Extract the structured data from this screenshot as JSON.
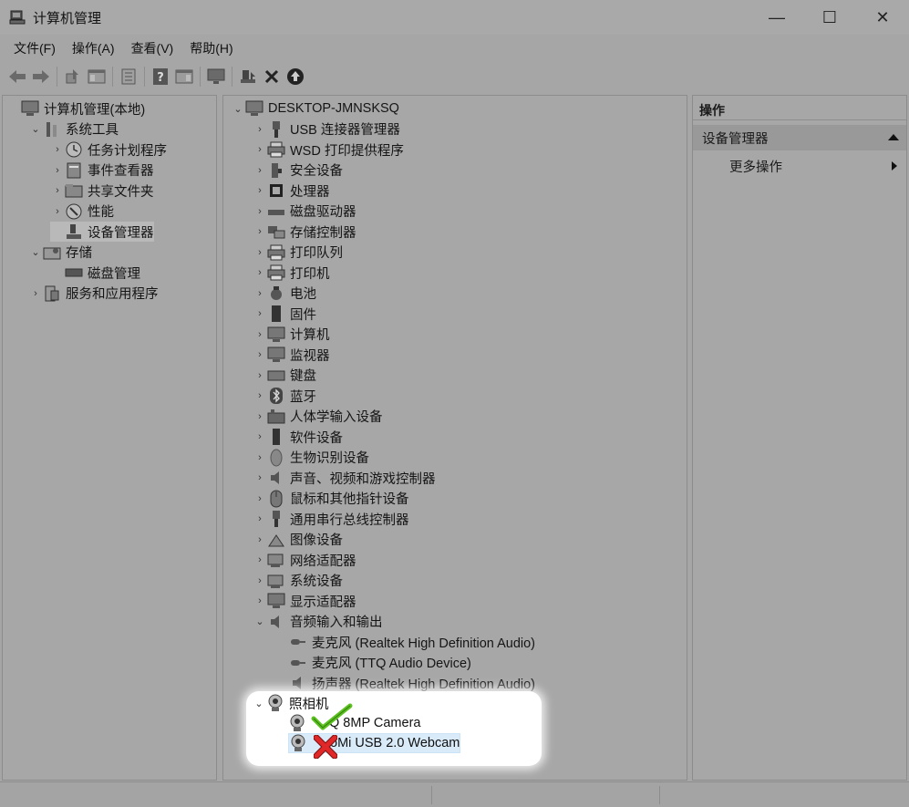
{
  "window": {
    "title": "计算机管理",
    "minimize_glyph": "—",
    "maximize_glyph": "☐",
    "close_glyph": "✕"
  },
  "menu": [
    "文件(F)",
    "操作(A)",
    "查看(V)",
    "帮助(H)"
  ],
  "toolbar": [
    "back-icon",
    "forward-icon",
    "up-icon",
    "properties-icon",
    "console-tree-icon",
    "help-icon",
    "panel-icon",
    "monitor-icon",
    "update-driver-icon",
    "uninstall-icon",
    "scan-hardware-icon"
  ],
  "left_tree": [
    {
      "label": "计算机管理(本地)",
      "level": 0,
      "chevron": "",
      "icon": "computer-management-icon"
    },
    {
      "label": "系统工具",
      "level": 1,
      "chevron": "⌄",
      "icon": "system-tools-icon"
    },
    {
      "label": "任务计划程序",
      "level": 2,
      "chevron": "›",
      "icon": "clock-icon"
    },
    {
      "label": "事件查看器",
      "level": 2,
      "chevron": "›",
      "icon": "event-viewer-icon"
    },
    {
      "label": "共享文件夹",
      "level": 2,
      "chevron": "›",
      "icon": "shared-folder-icon"
    },
    {
      "label": "性能",
      "level": 2,
      "chevron": "›",
      "icon": "performance-icon"
    },
    {
      "label": "设备管理器",
      "level": 2,
      "chevron": "",
      "icon": "device-manager-icon",
      "selected": true
    },
    {
      "label": "存储",
      "level": 1,
      "chevron": "⌄",
      "icon": "storage-icon"
    },
    {
      "label": "磁盘管理",
      "level": 2,
      "chevron": "",
      "icon": "disk-icon"
    },
    {
      "label": "服务和应用程序",
      "level": 1,
      "chevron": "›",
      "icon": "services-icon"
    }
  ],
  "device_tree": {
    "root": "DESKTOP-JMNSKSQ",
    "categories": [
      {
        "label": "USB 连接器管理器",
        "icon": "usb-icon"
      },
      {
        "label": "WSD 打印提供程序",
        "icon": "printer-icon"
      },
      {
        "label": "安全设备",
        "icon": "security-icon"
      },
      {
        "label": "处理器",
        "icon": "processor-icon"
      },
      {
        "label": "磁盘驱动器",
        "icon": "disk-drive-icon"
      },
      {
        "label": "存储控制器",
        "icon": "storage-controller-icon"
      },
      {
        "label": "打印队列",
        "icon": "print-queue-icon"
      },
      {
        "label": "打印机",
        "icon": "printer-icon"
      },
      {
        "label": "电池",
        "icon": "battery-icon"
      },
      {
        "label": "固件",
        "icon": "firmware-icon"
      },
      {
        "label": "计算机",
        "icon": "computer-icon"
      },
      {
        "label": "监视器",
        "icon": "monitor-icon"
      },
      {
        "label": "键盘",
        "icon": "keyboard-icon"
      },
      {
        "label": "蓝牙",
        "icon": "bluetooth-icon"
      },
      {
        "label": "人体学输入设备",
        "icon": "hid-icon"
      },
      {
        "label": "软件设备",
        "icon": "software-device-icon"
      },
      {
        "label": "生物识别设备",
        "icon": "biometric-icon"
      },
      {
        "label": "声音、视频和游戏控制器",
        "icon": "speaker-icon"
      },
      {
        "label": "鼠标和其他指针设备",
        "icon": "mouse-icon"
      },
      {
        "label": "通用串行总线控制器",
        "icon": "usb-icon"
      },
      {
        "label": "图像设备",
        "icon": "imaging-icon"
      },
      {
        "label": "网络适配器",
        "icon": "network-icon"
      },
      {
        "label": "系统设备",
        "icon": "system-device-icon"
      },
      {
        "label": "显示适配器",
        "icon": "display-adapter-icon"
      }
    ],
    "audio": {
      "label": "音频输入和输出",
      "children": [
        "麦克风 (Realtek High Definition Audio)",
        "麦克风 (TTQ Audio Device)",
        "扬声器 (Realtek High Definition Audio)"
      ]
    },
    "cameras": {
      "label": "照相机",
      "children": [
        {
          "label": "Q 8MP Camera",
          "mark": "check-mark-icon",
          "mark_color": "#5cc020"
        },
        {
          "label": "oMi USB 2.0 Webcam",
          "mark": "cross-mark-icon",
          "mark_color": "#e02828",
          "selected": true
        }
      ]
    }
  },
  "actions_pane": {
    "header": "操作",
    "section": "设备管理器",
    "item": "更多操作"
  }
}
